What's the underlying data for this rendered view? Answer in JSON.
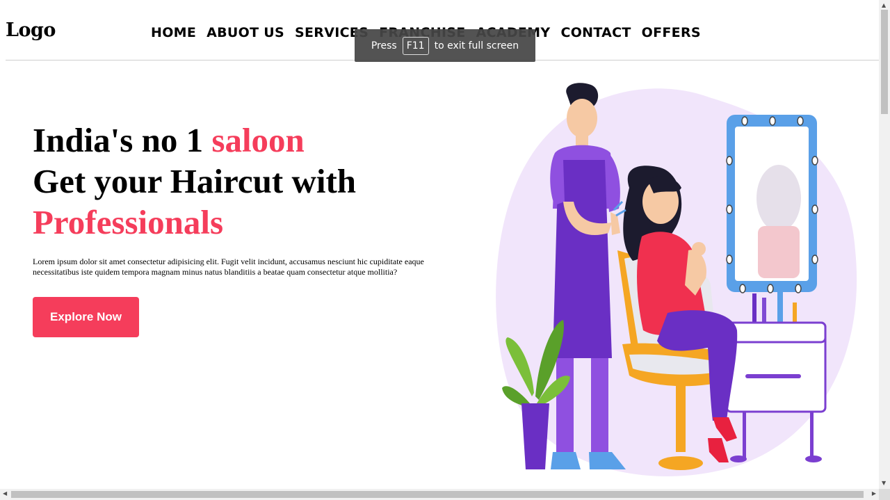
{
  "header": {
    "logo": "Logo",
    "nav": [
      "HOME",
      "ABUOT US",
      "SERVICES",
      "FRANCHISE",
      "ACADEMY",
      "CONTACT",
      "OFFERS"
    ]
  },
  "fullscreen_toast": {
    "prefix": "Press",
    "key": "F11",
    "suffix": "to exit full screen"
  },
  "hero": {
    "line1": "India's no 1 ",
    "line1_highlight": "saloon",
    "line2": "Get your Haircut with",
    "line3_highlight": "Professionals",
    "description": "Lorem ipsum dolor sit amet consectetur adipisicing elit. Fugit velit incidunt, accusamus nesciunt hic cupiditate eaque necessitatibus iste quidem tempora magnam minus natus blanditiis a beatae quam consectetur atque mollitia?",
    "cta_label": "Explore Now"
  },
  "colors": {
    "accent": "#f53d5b",
    "blob": "#f1e5fb",
    "apron": "#6a2fc4",
    "mirror_frame": "#5aa0e8"
  },
  "illustration": {
    "name": "barber-cutting-hair-illustration"
  },
  "scrollbars": {
    "up": "▲",
    "down": "▼",
    "left": "◀",
    "right": "▶"
  }
}
